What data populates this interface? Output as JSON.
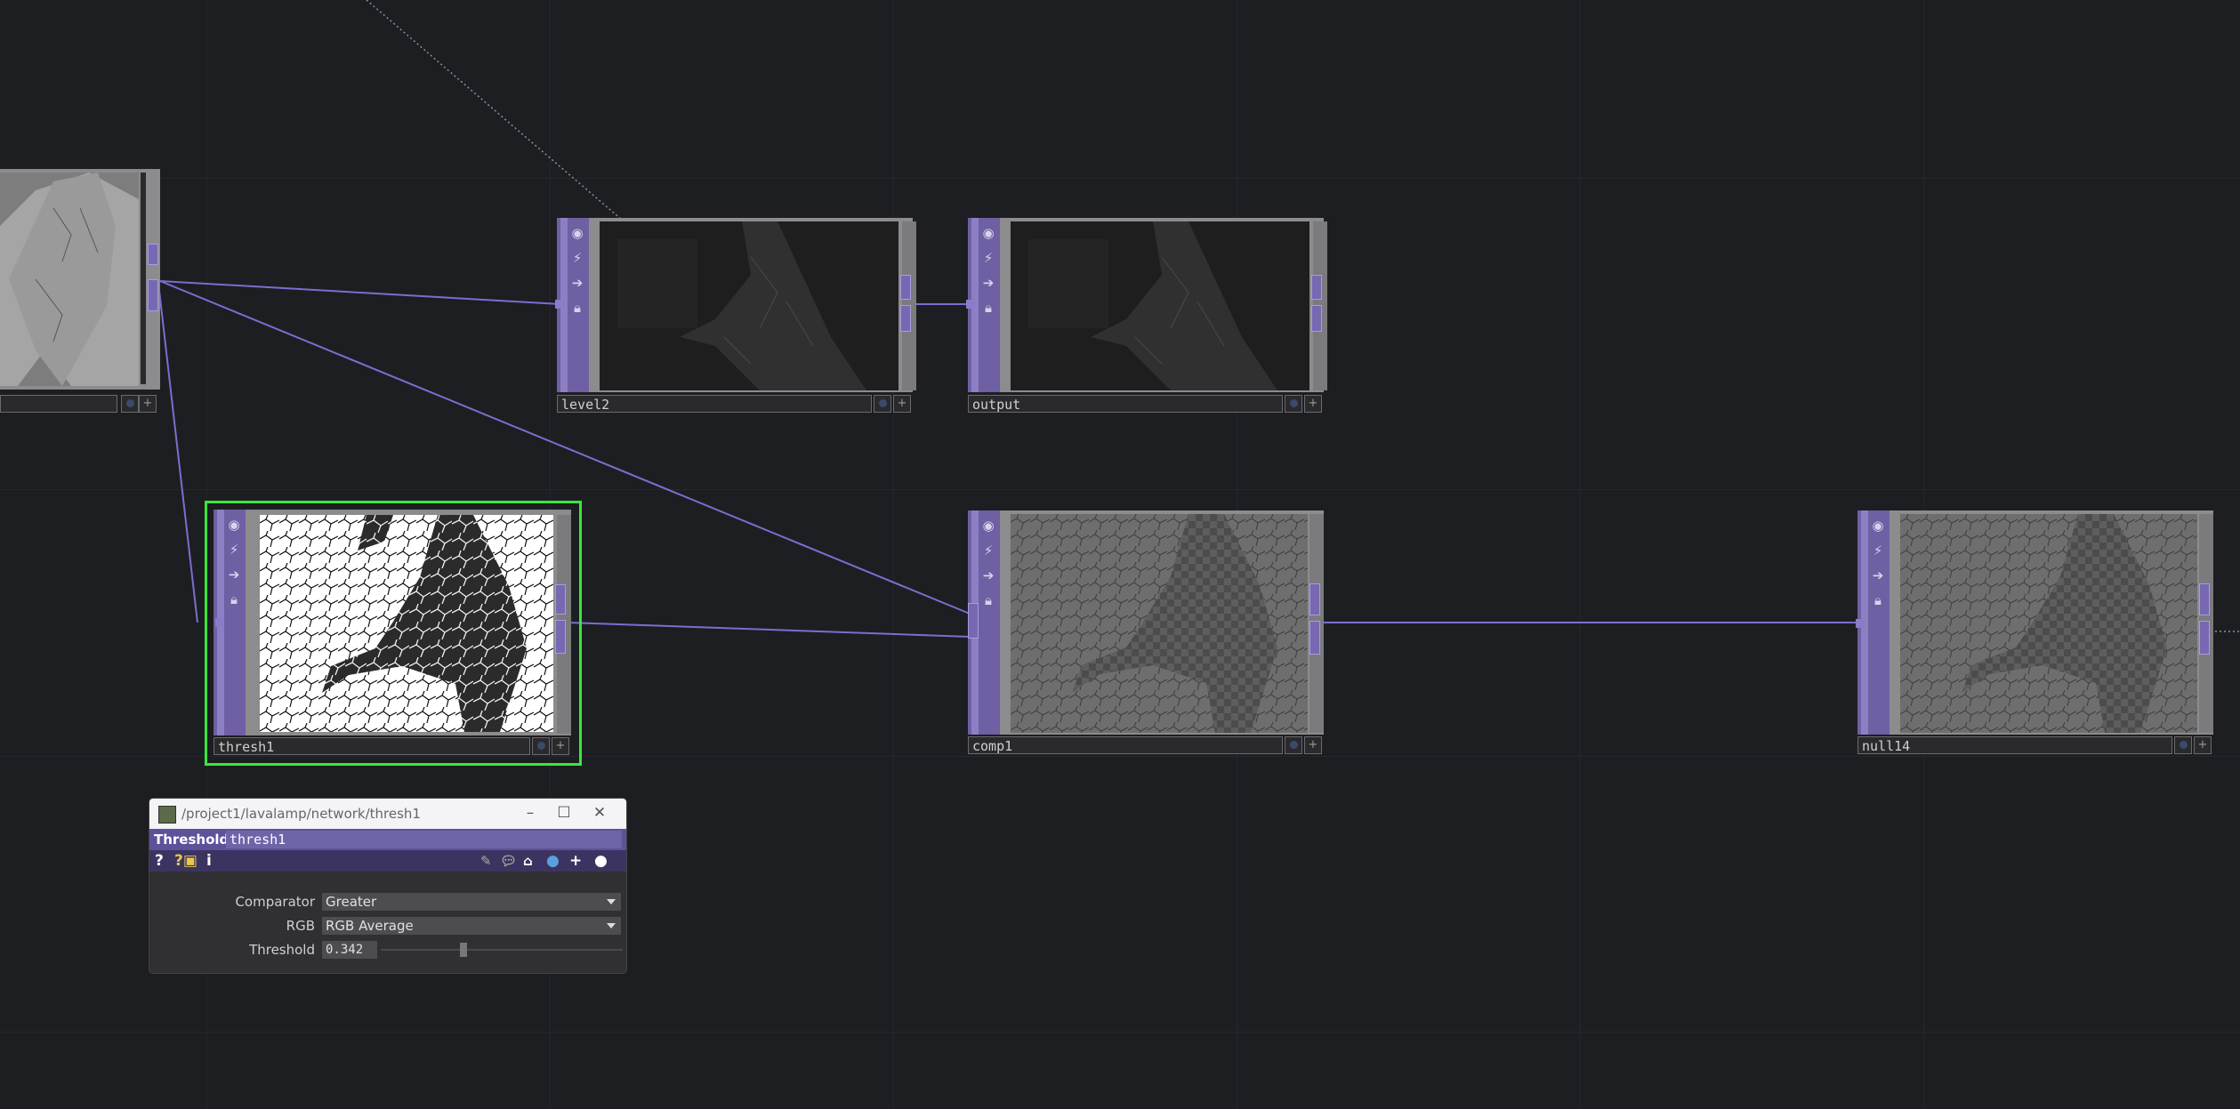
{
  "nodes": {
    "partial_left": {
      "label": ""
    },
    "level2": {
      "label": "level2"
    },
    "output": {
      "label": "output"
    },
    "thresh1": {
      "label": "thresh1"
    },
    "comp1": {
      "label": "comp1"
    },
    "null14": {
      "label": "null14"
    }
  },
  "sidebar_icons": [
    "viewer-icon",
    "cook-icon",
    "export-icon",
    "lock-icon"
  ],
  "colors": {
    "selected_outline": "#3be63b",
    "wire": "#7a6ed0",
    "node_sidebar": "#6f5fa3"
  },
  "param_window": {
    "path": "/project1/lavalamp/network/thresh1",
    "op_type": "Threshold",
    "op_name": "thresh1",
    "comparator_label": "Comparator",
    "comparator_value": "Greater",
    "rgb_label": "RGB",
    "rgb_value": "RGB Average",
    "threshold_label": "Threshold",
    "threshold_value": "0.342",
    "threshold_fraction": 0.342
  }
}
